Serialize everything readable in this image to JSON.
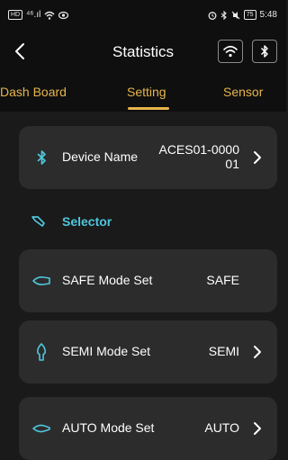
{
  "status_bar": {
    "left_box": "HD",
    "left_signal": "⁴⁶.ıl",
    "battery": "75",
    "time": "5:48"
  },
  "header": {
    "title": "Statistics"
  },
  "tabs": [
    {
      "label": "Dash Board"
    },
    {
      "label": "Setting",
      "active": true
    },
    {
      "label": "Sensor"
    }
  ],
  "device": {
    "label": "Device Name",
    "value_line1": "ACES01-0000",
    "value_line2": "01",
    "icon": "bluetooth-icon"
  },
  "selector": {
    "label": "Selector",
    "icon": "selector-icon"
  },
  "modes": [
    {
      "label": "SAFE Mode Set",
      "value": "SAFE",
      "icon": "safe-mode-icon",
      "has_chevron": false
    },
    {
      "label": "SEMI Mode Set",
      "value": "SEMI",
      "icon": "semi-mode-icon",
      "has_chevron": true
    },
    {
      "label": "AUTO Mode Set",
      "value": "AUTO",
      "icon": "auto-mode-icon",
      "has_chevron": true
    }
  ],
  "colors": {
    "accent": "#e7b54b",
    "selector": "#4fc6dc",
    "card_bg": "#2c2c2c",
    "bg": "#1a1a1a"
  }
}
